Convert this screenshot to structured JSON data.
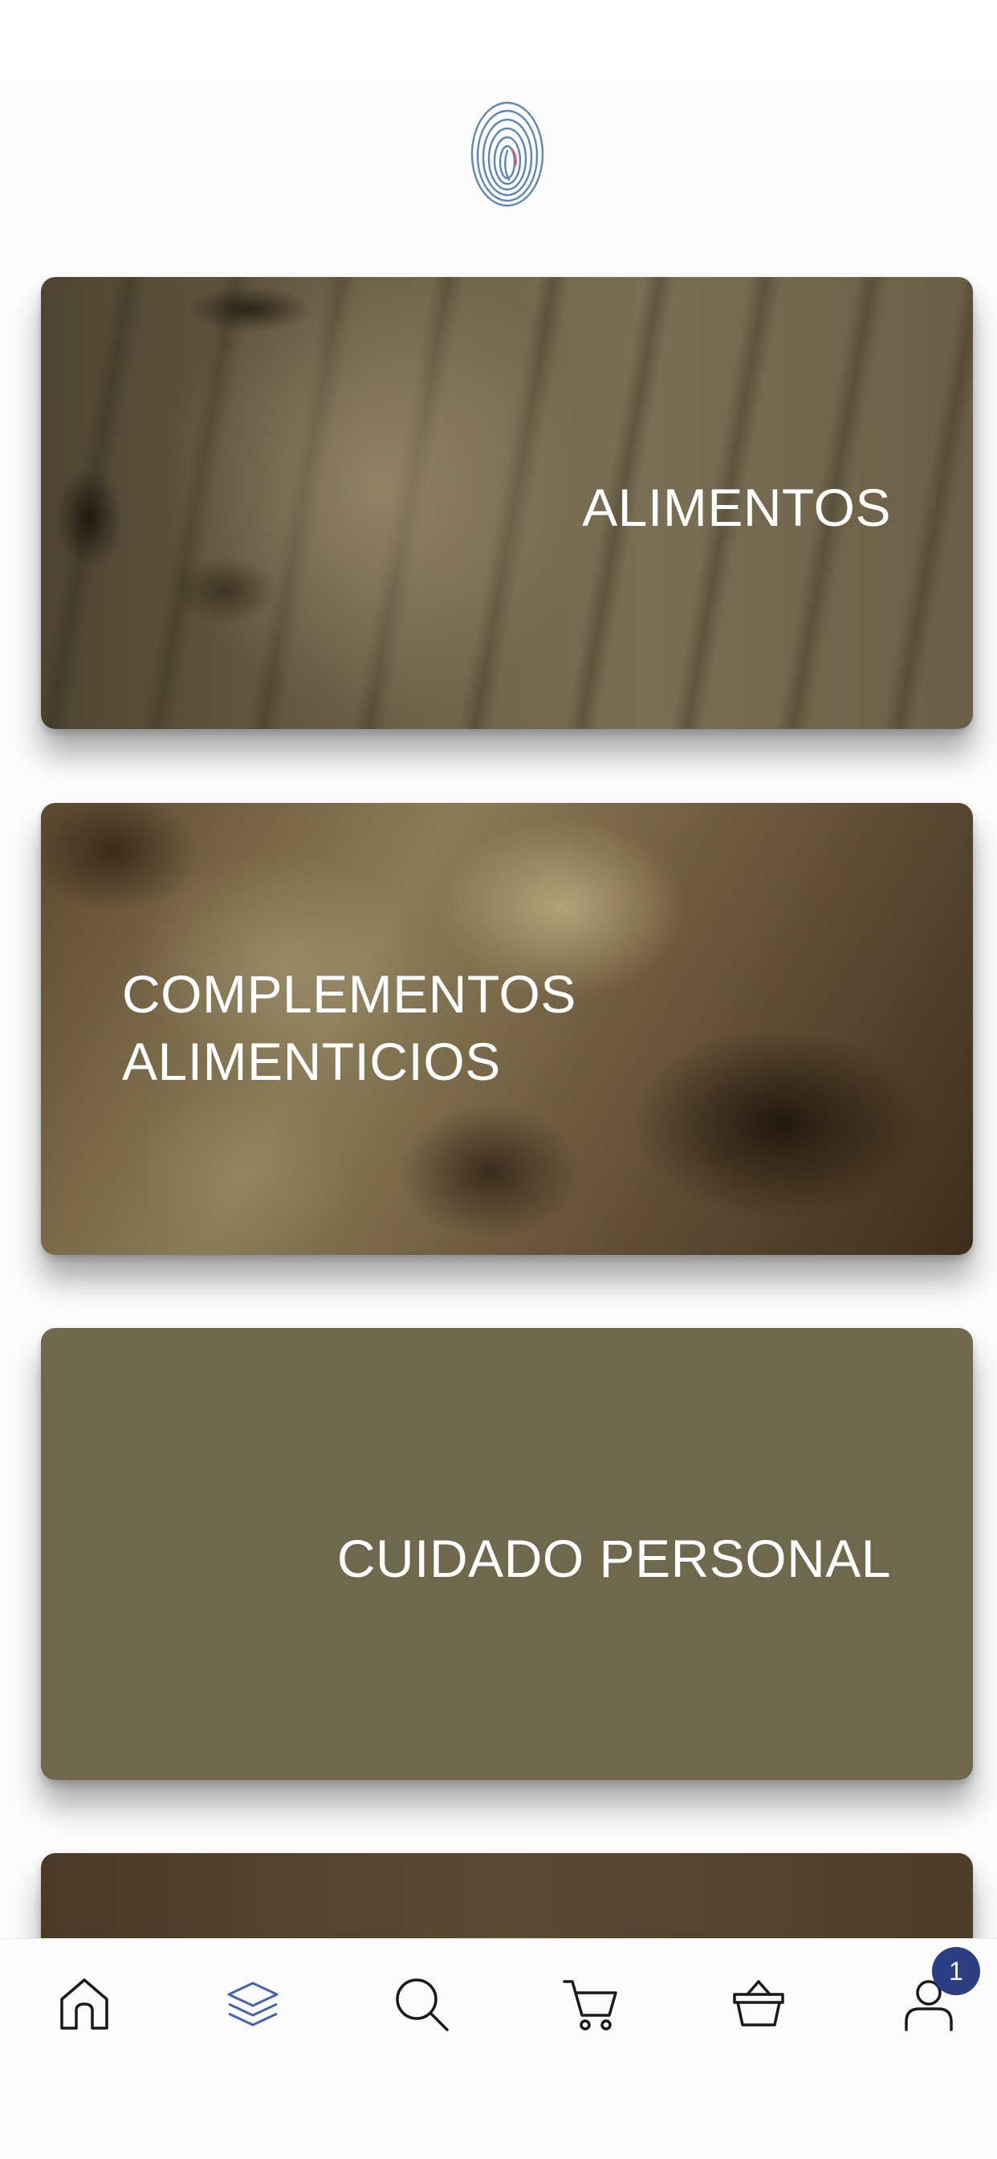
{
  "categories": [
    {
      "label": "ALIMENTOS"
    },
    {
      "label": "COMPLEMENTOS\nALIMENTICIOS"
    },
    {
      "label": "CUIDADO PERSONAL"
    },
    {
      "label": ""
    }
  ],
  "tabbar": {
    "items": [
      {
        "icon": "home-icon",
        "active": false
      },
      {
        "icon": "layers-icon",
        "active": true
      },
      {
        "icon": "search-icon",
        "active": false
      },
      {
        "icon": "cart-icon",
        "active": false
      },
      {
        "icon": "basket-icon",
        "active": false
      },
      {
        "icon": "user-icon",
        "active": false
      }
    ],
    "user_badge": "1",
    "active_color": "#4a63a8",
    "icon_color": "#1a1a1a",
    "badge_color": "#2b3f82"
  },
  "logo": {
    "icon": "fingerprint-icon",
    "color": "#5d86b8"
  }
}
